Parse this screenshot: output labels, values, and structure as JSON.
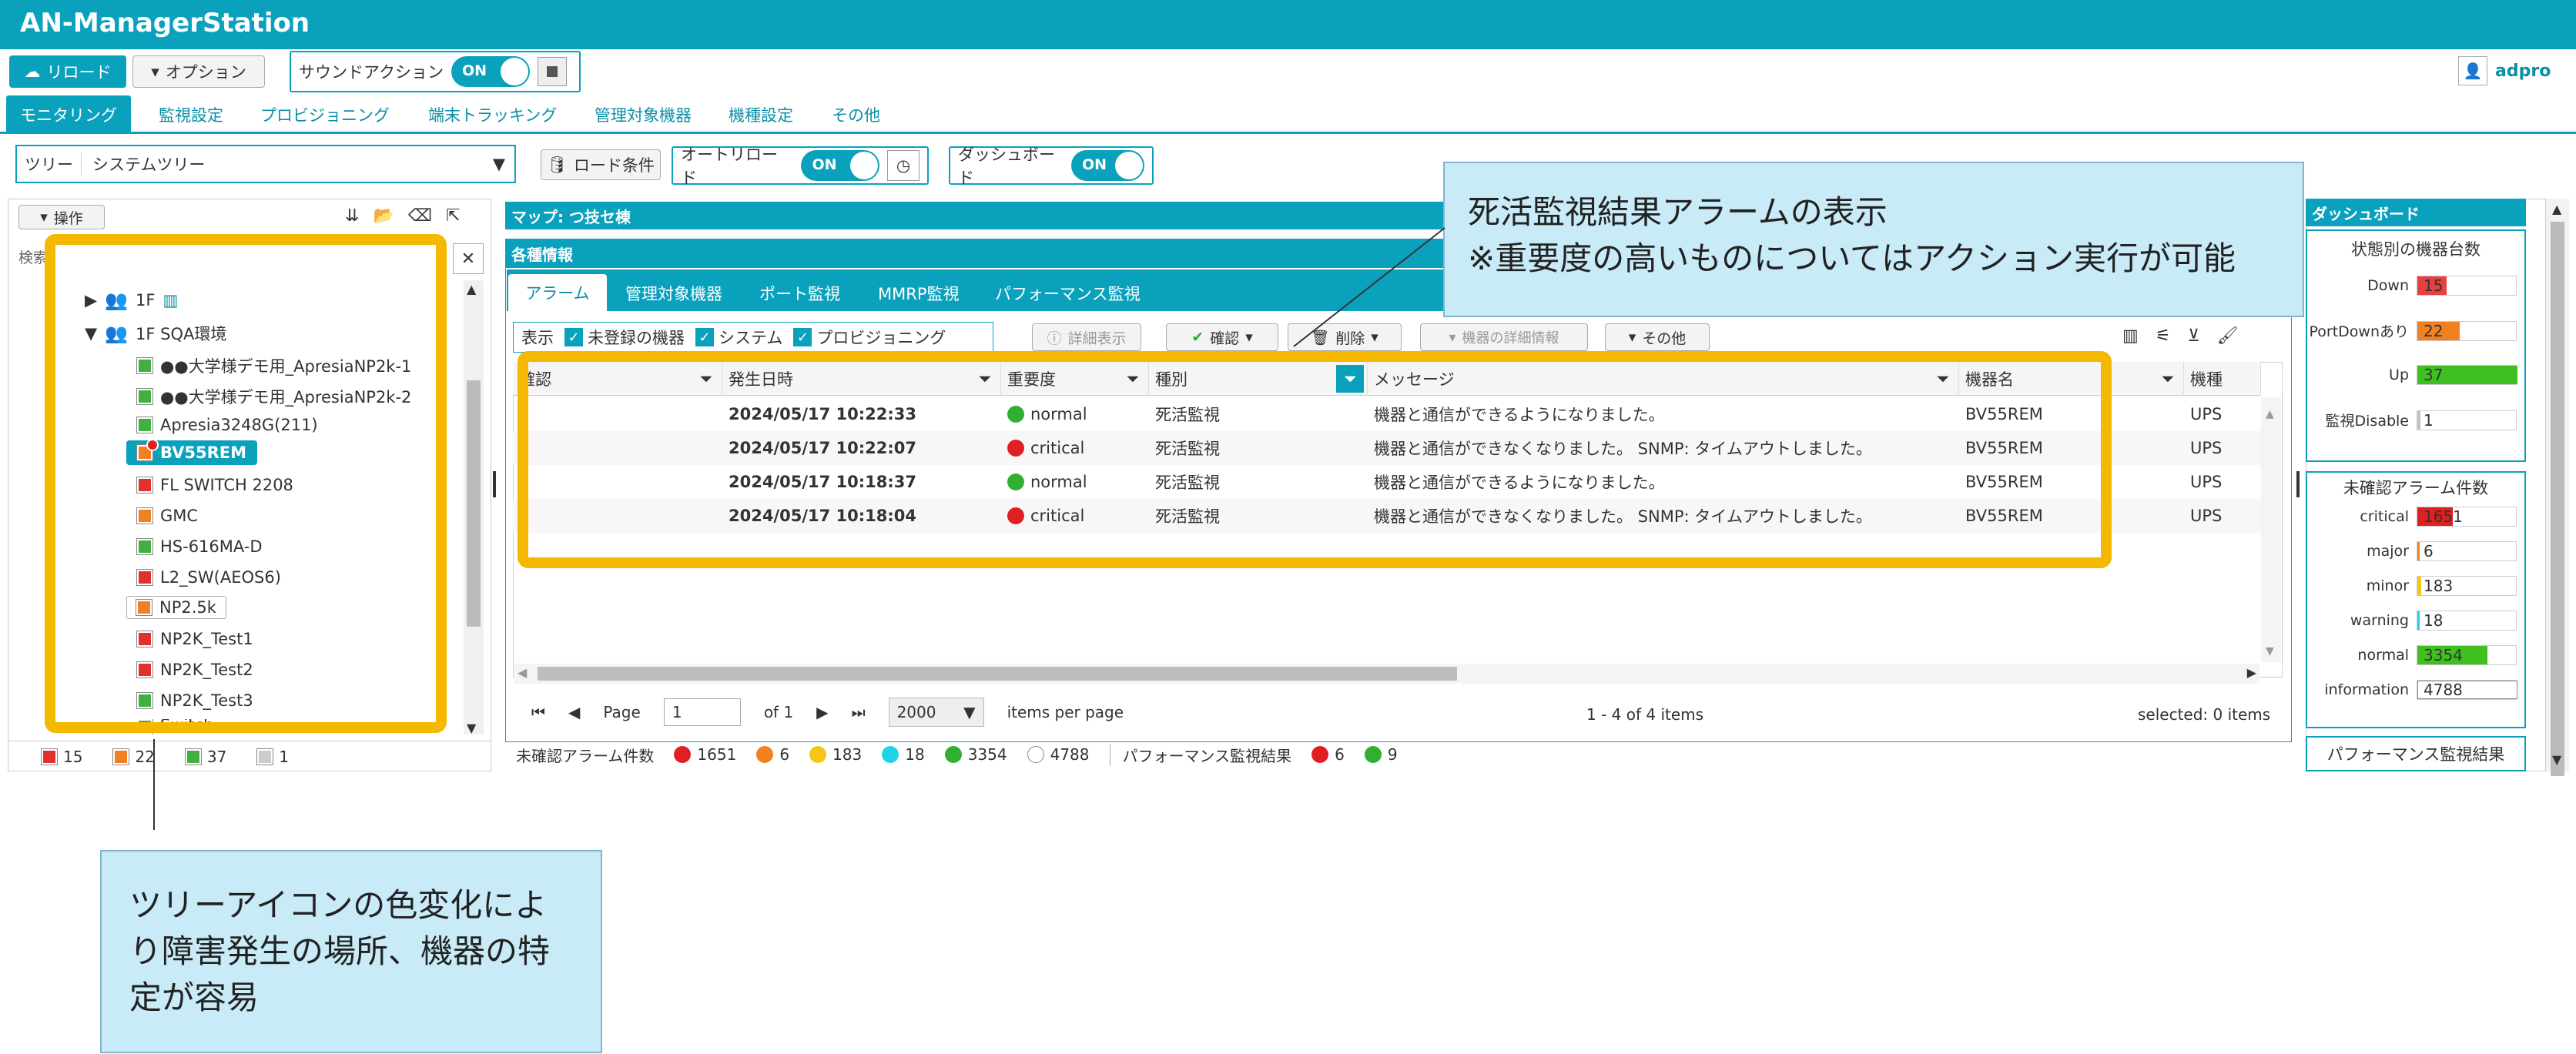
{
  "app_title": "AN-ManagerStation",
  "toolbar": {
    "reload": "リロード",
    "options": "オプション",
    "sound_action": "サウンドアクション",
    "sound_toggle": "ON",
    "user": "adpro"
  },
  "nav_tabs": [
    "モニタリング",
    "監視設定",
    "プロビジョニング",
    "端末トラッキング",
    "管理対象機器",
    "機種設定",
    "その他"
  ],
  "controls": {
    "tree_label": "ツリー",
    "tree_value": "システムツリー",
    "load_condition": "ロード条件",
    "auto_reload": "オートリロード",
    "auto_reload_toggle": "ON",
    "dashboard": "ダッシュボード",
    "dashboard_toggle": "ON"
  },
  "left_panel": {
    "ops_label": "操作",
    "search_label": "検索",
    "tree_items": [
      {
        "label": "1F",
        "color": "#f08020",
        "level": 1
      },
      {
        "label": "1F SQA環境",
        "color": "#e03030",
        "level": 1
      },
      {
        "label": "●●大学様デモ用_ApresiaNP2k-1",
        "color": "#40b040",
        "level": 2
      },
      {
        "label": "●●大学様デモ用_ApresiaNP2k-2",
        "color": "#40b040",
        "level": 2
      },
      {
        "label": "Apresia3248G(211)",
        "color": "#40b040",
        "level": 2
      },
      {
        "label": "BV55REM",
        "color": "#f08020",
        "level": 2,
        "selected": true
      },
      {
        "label": "FL SWITCH 2208",
        "color": "#e03030",
        "level": 2
      },
      {
        "label": "GMC",
        "color": "#f08020",
        "level": 2
      },
      {
        "label": "HS-616MA-D",
        "color": "#40b040",
        "level": 2
      },
      {
        "label": "L2_SW(AEOS6)",
        "color": "#e03030",
        "level": 2
      },
      {
        "label": "NP2.5k",
        "color": "#f08020",
        "level": 2
      },
      {
        "label": "NP2K_Test1",
        "color": "#e03030",
        "level": 2
      },
      {
        "label": "NP2K_Test2",
        "color": "#e03030",
        "level": 2
      },
      {
        "label": "NP2K_Test3",
        "color": "#40b040",
        "level": 2
      },
      {
        "label": "Switch",
        "color": "#40b040",
        "level": 2
      }
    ],
    "footer_counts": [
      "15",
      "22",
      "37",
      "1"
    ]
  },
  "map": {
    "title": "マップ: つ技セ棟"
  },
  "info": {
    "title": "各種情報",
    "tabs": [
      "アラーム",
      "管理対象機器",
      "ポート監視",
      "MMRP監視",
      "パフォーマンス監視"
    ],
    "filter_label": "表示",
    "filters": [
      "未登録の機器",
      "システム",
      "プロビジョニング"
    ],
    "actions": {
      "details": "詳細表示",
      "confirm": "確認",
      "delete": "削除",
      "device_details": "機器の詳細情報",
      "other": "その他"
    },
    "columns": [
      "確認",
      "発生日時",
      "重要度",
      "種別",
      "メッセージ",
      "機器名",
      "機種"
    ],
    "rows": [
      {
        "time": "2024/05/17 10:22:33",
        "severity": "normal",
        "type": "死活監視",
        "message": "機器と通信ができるようになりました。",
        "device": "BV55REM",
        "model": "UPS"
      },
      {
        "time": "2024/05/17 10:22:07",
        "severity": "critical",
        "type": "死活監視",
        "message": "機器と通信ができなくなりました。 SNMP: タイムアウトしました。",
        "device": "BV55REM",
        "model": "UPS"
      },
      {
        "time": "2024/05/17 10:18:37",
        "severity": "normal",
        "type": "死活監視",
        "message": "機器と通信ができるようになりました。",
        "device": "BV55REM",
        "model": "UPS"
      },
      {
        "time": "2024/05/17 10:18:04",
        "severity": "critical",
        "type": "死活監視",
        "message": "機器と通信ができなくなりました。 SNMP: タイムアウトしました。",
        "device": "BV55REM",
        "model": "UPS"
      }
    ],
    "pager": {
      "page_label": "Page",
      "page": "1",
      "of": "of 1",
      "per_page": "2000",
      "items_per_page": "items per page",
      "range": "1 - 4 of 4 items",
      "selected": "selected: 0 items"
    },
    "status": {
      "unconfirmed_label": "未確認アラーム件数",
      "counts": [
        {
          "value": "1651",
          "color": "#e02020"
        },
        {
          "value": "6",
          "color": "#f08020"
        },
        {
          "value": "183",
          "color": "#f5c518"
        },
        {
          "value": "18",
          "color": "#22d0e8"
        },
        {
          "value": "3354",
          "color": "#30b030"
        },
        {
          "value": "4788",
          "color": "#ffffff"
        }
      ],
      "perf_label": "パフォーマンス監視結果",
      "perf_counts": [
        {
          "value": "6",
          "color": "#e02020"
        },
        {
          "value": "9",
          "color": "#30b030"
        }
      ]
    }
  },
  "dashboard": {
    "title": "ダッシュボード",
    "state_title": "状態別の機器台数",
    "states": [
      {
        "label": "Down",
        "value": "15",
        "color": "#e84040",
        "fraction": 0.29
      },
      {
        "label": "PortDownあり",
        "value": "22",
        "color": "#f08020",
        "fraction": 0.42
      },
      {
        "label": "Up",
        "value": "37",
        "color": "#40c020",
        "fraction": 1.0
      },
      {
        "label": "監視Disable",
        "value": "1",
        "color": "#c0c0c0",
        "fraction": 0.03
      }
    ],
    "alarm_title": "未確認アラーム件数",
    "alarms": [
      {
        "label": "critical",
        "value": "1651",
        "color": "#e02020",
        "fraction": 0.35
      },
      {
        "label": "major",
        "value": "6",
        "color": "#f08020",
        "fraction": 0.01
      },
      {
        "label": "minor",
        "value": "183",
        "color": "#f5c518",
        "fraction": 0.04
      },
      {
        "label": "warning",
        "value": "18",
        "color": "#22d0e8",
        "fraction": 0.01
      },
      {
        "label": "normal",
        "value": "3354",
        "color": "#40c020",
        "fraction": 0.7
      },
      {
        "label": "information",
        "value": "4788",
        "color": "#ffffff",
        "fraction": 1.0
      }
    ],
    "perf_title": "パフォーマンス監視結果"
  },
  "callouts": {
    "top_line1": "死活監視結果アラームの表示",
    "top_line2": "※重要度の高いものについてはアクション実行が可能",
    "bottom": "ツリーアイコンの色変化により障害発生の場所、機器の特定が容易"
  }
}
